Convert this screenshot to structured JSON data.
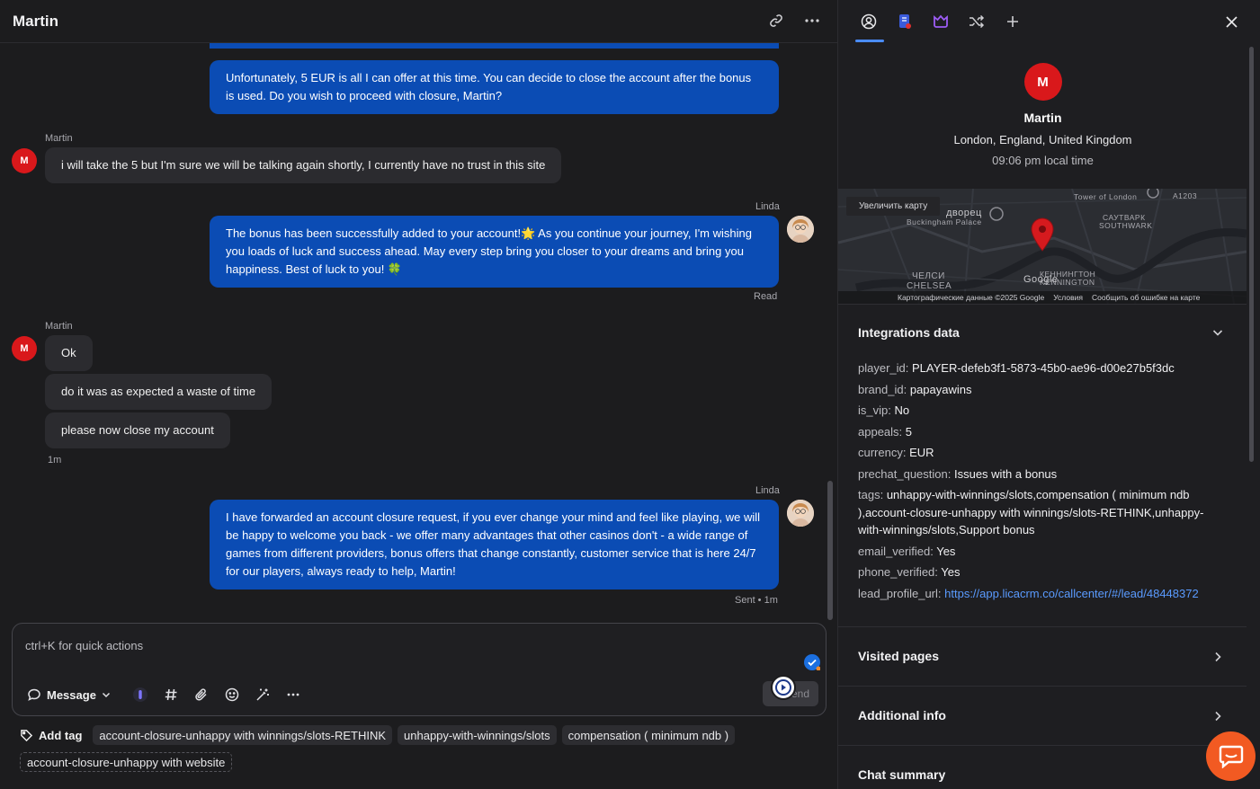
{
  "header": {
    "title": "Martin"
  },
  "messages": {
    "agent1_text": "Unfortunately, 5 EUR is all I can offer at this time. You can decide to close the account after the bonus is used. Do you wish to proceed with closure, Martin?",
    "user1_sender": "Martin",
    "user1_text": "i will take the 5 but I'm sure we will be talking again shortly, I currently have no trust in this site",
    "agent2_sender": "Linda",
    "agent2_text": "The bonus has been successfully added to your account!🌟 As you continue your journey, I'm wishing you loads of luck and success ahead. May every step bring you closer to your dreams and bring you happiness. Best of luck to you! 🍀",
    "agent2_status": "Read",
    "user2_sender": "Martin",
    "user2_msg1": "Ok",
    "user2_msg2": "do it was as expected a waste of time",
    "user2_msg3": "please now close my account",
    "user2_time": "1m",
    "agent3_sender": "Linda",
    "agent3_text": "I have forwarded an account closure request, if you ever change your mind and feel like playing, we will be happy to welcome you back - we offer many advantages that other casinos don't - a wide range of games from different providers, bonus offers that change constantly, customer service that is here 24/7 for our players, always ready to help, Martin!",
    "agent3_status": "Sent • 1m",
    "avatar_initial": "M"
  },
  "composer": {
    "placeholder": "ctrl+K for quick actions",
    "message_type": "Message",
    "send_label": "Send"
  },
  "tags": {
    "add_label": "Add tag",
    "items": [
      "account-closure-unhappy with winnings/slots-RETHINK",
      "unhappy-with-winnings/slots",
      "compensation ( minimum ndb )"
    ],
    "pending": "account-closure-unhappy with website"
  },
  "profile": {
    "initial": "M",
    "name": "Martin",
    "location": "London, England, United Kingdom",
    "local_time": "09:06 pm local time"
  },
  "map": {
    "zoom_button": "Увеличить карту",
    "labels": {
      "palace": "дворец",
      "buckingham": "Buckingham Palace",
      "chelsea1": "ЧЕЛСИ",
      "chelsea2": "CHELSEA",
      "southwark1": "САУТВАРК",
      "southwark2": "SOUTHWARK",
      "kennington1": "КЕННИНГТОН",
      "kennington2": "KENNINGTON",
      "tower": "Tower of London",
      "road": "A1203",
      "google": "Google"
    },
    "footer": {
      "data": "Картографические данные ©2025 Google",
      "terms": "Условия",
      "report": "Сообщить об ошибке на карте"
    }
  },
  "integrations": {
    "title": "Integrations data",
    "rows": [
      {
        "key": "player_id:",
        "value": "PLAYER-defeb3f1-5873-45b0-ae96-d00e27b5f3dc"
      },
      {
        "key": "brand_id:",
        "value": "papayawins"
      },
      {
        "key": "is_vip:",
        "value": "No"
      },
      {
        "key": "appeals:",
        "value": "5"
      },
      {
        "key": "currency:",
        "value": "EUR"
      },
      {
        "key": "prechat_question:",
        "value": "Issues with a bonus"
      },
      {
        "key": "tags:",
        "value": "unhappy-with-winnings/slots,compensation ( minimum ndb ),account-closure-unhappy with winnings/slots-RETHINK,unhappy-with-winnings/slots,Support bonus"
      },
      {
        "key": "email_verified:",
        "value": "Yes"
      },
      {
        "key": "phone_verified:",
        "value": "Yes"
      },
      {
        "key": "lead_profile_url:",
        "value": "https://app.licacrm.co/callcenter/#/lead/48448372"
      }
    ]
  },
  "sections": {
    "visited": "Visited pages",
    "additional": "Additional info",
    "summary": "Chat summary"
  },
  "colors": {
    "agent_bubble": "#0b4cb4",
    "user_bubble": "#2b2b2f",
    "avatar_red": "#d9181b",
    "link": "#5a9bff",
    "fab": "#f25a22"
  }
}
